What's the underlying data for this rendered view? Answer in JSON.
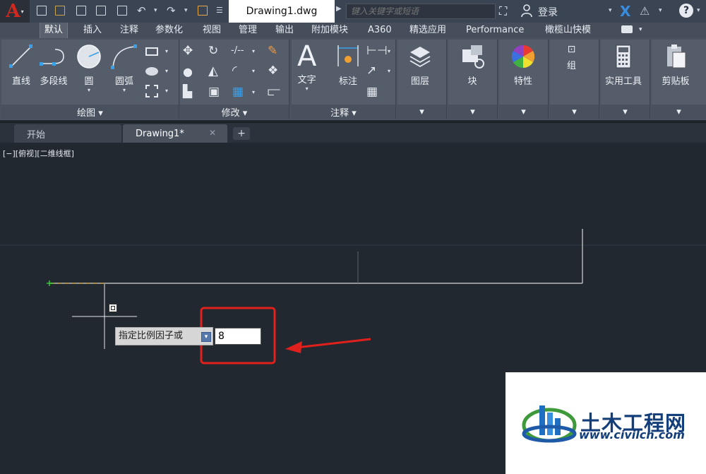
{
  "titlebar": {
    "doc_title": "Drawing1.dwg",
    "search_placeholder": "键入关键字或短语",
    "login_label": "登录"
  },
  "ribbon_tabs": [
    "默认",
    "插入",
    "注释",
    "参数化",
    "视图",
    "管理",
    "输出",
    "附加模块",
    "A360",
    "精选应用",
    "Performance",
    "橄榄山快模"
  ],
  "active_tab": "默认",
  "panels": {
    "draw": {
      "title": "绘图 ▾",
      "line": "直线",
      "polyline": "多段线",
      "circle": "圆",
      "arc": "圆弧"
    },
    "modify": {
      "title": "修改 ▾"
    },
    "annotation": {
      "title": "注释 ▾",
      "text": "文字",
      "dimension": "标注"
    },
    "layers": {
      "label": "图层"
    },
    "block": {
      "label": "块"
    },
    "properties": {
      "label": "特性"
    },
    "group": {
      "label": "组"
    },
    "utilities": {
      "label": "实用工具"
    },
    "clipboard": {
      "label": "剪贴板"
    }
  },
  "file_tabs": {
    "start": "开始",
    "drawing": "Drawing1*",
    "close": "✕",
    "add": "+"
  },
  "canvas": {
    "viewport_label": "[−][俯视][二维线框]",
    "command_prompt": "指定比例因子或",
    "scale_input_value": "8"
  },
  "watermark": {
    "text": "土木工程网",
    "url": "www.civilcn.com"
  },
  "colors": {
    "highlight_red": "#e0201c",
    "canvas_bg": "#212830",
    "ribbon_bg": "#555d6b"
  }
}
